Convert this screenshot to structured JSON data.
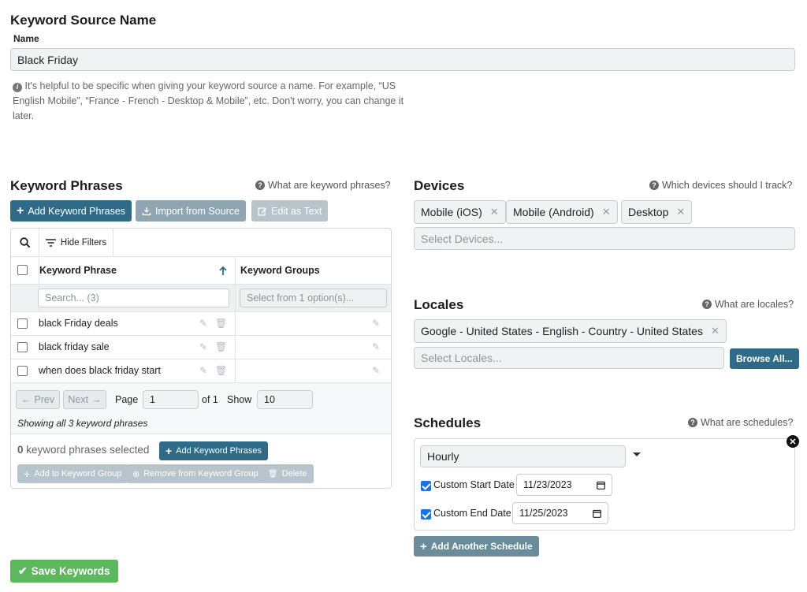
{
  "source": {
    "heading": "Keyword Source Name",
    "name_label": "Name",
    "name_value": "Black Friday",
    "hint": "It's helpful to be specific when giving your keyword source a name. For example, “US English Mobile”, “France - French - Desktop & Mobile”, etc. Don't worry, you can change it later."
  },
  "phrases": {
    "heading": "Keyword Phrases",
    "help": "What are keyword phrases?",
    "add_btn": "Add Keyword Phrases",
    "import_btn": "Import from Source",
    "edit_btn": "Edit as Text",
    "hide_filters": "Hide Filters",
    "col_phrase": "Keyword Phrase",
    "col_groups": "Keyword Groups",
    "search_placeholder": "Search... (3)",
    "groups_placeholder": "Select from 1 option(s)...",
    "rows": [
      "black Friday deals",
      "black friday sale",
      "when does black friday start"
    ],
    "prev": "Prev",
    "next": "Next",
    "page_label": "Page",
    "page_value": "1",
    "of_label": "of 1",
    "show_label": "Show",
    "show_value": "10",
    "showing": "Showing all 3 keyword phrases",
    "selected_count": "0",
    "selected_label": "keyword phrases selected",
    "add_footer_btn": "Add Keyword Phrases",
    "add_group_btn": "Add to Keyword Group",
    "remove_group_btn": "Remove from Keyword Group",
    "delete_btn": "Delete"
  },
  "devices": {
    "heading": "Devices",
    "help": "Which devices should I track?",
    "chips": [
      "Mobile (iOS)",
      "Mobile (Android)",
      "Desktop"
    ],
    "placeholder": "Select Devices..."
  },
  "locales": {
    "heading": "Locales",
    "help": "What are locales?",
    "chip": "Google - United States - English - Country - United States",
    "placeholder": "Select Locales...",
    "browse_btn": "Browse All..."
  },
  "schedules": {
    "heading": "Schedules",
    "help": "What are schedules?",
    "frequency": "Hourly",
    "start_label": "Custom Start Date",
    "start_value": "11/23/2023",
    "end_label": "Custom End Date",
    "end_value": "11/25/2023",
    "add_btn": "Add Another Schedule"
  },
  "save_btn": "Save Keywords",
  "colors": {
    "primary": "#2f6b86",
    "success": "#5cb85c",
    "checkbox": "#1a73e8"
  }
}
